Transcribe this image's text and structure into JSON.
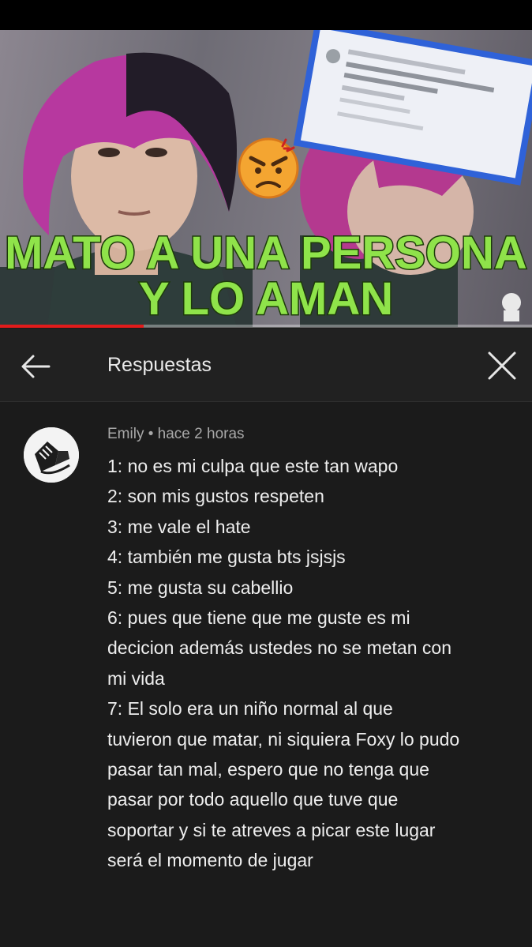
{
  "thumbnail": {
    "title_line1": "MATO A UNA PERSONA",
    "title_line2": "Y LO AMAN",
    "emoji": "angry-face",
    "colors": {
      "title_fill": "#8fe34a",
      "hair": "#b83aa8",
      "frame": "#2f62d8"
    }
  },
  "video_progress": {
    "fraction": 0.27
  },
  "header": {
    "title": "Respuestas",
    "back_icon": "arrow-left-icon",
    "close_icon": "close-icon"
  },
  "comment": {
    "author": "Emily",
    "separator": "•",
    "time": "hace 2 horas",
    "lines": [
      "1: no es mi culpa que este tan wapo",
      "2: son mis gustos respeten",
      "3: me vale el hate",
      "4: también me gusta bts jsjsjs",
      "5: me gusta su cabellio",
      "6: pues que tiene que me guste es mi",
      "decicion además ustedes no se metan con",
      "mi vida",
      "7: El solo era un niño normal al que",
      "tuvieron que matar, ni siquiera Foxy lo pudo",
      "pasar tan mal, espero que no tenga que",
      "pasar por todo aquello que tuve que",
      "soportar y si te atreves a picar este lugar",
      "será el momento de jugar"
    ]
  }
}
